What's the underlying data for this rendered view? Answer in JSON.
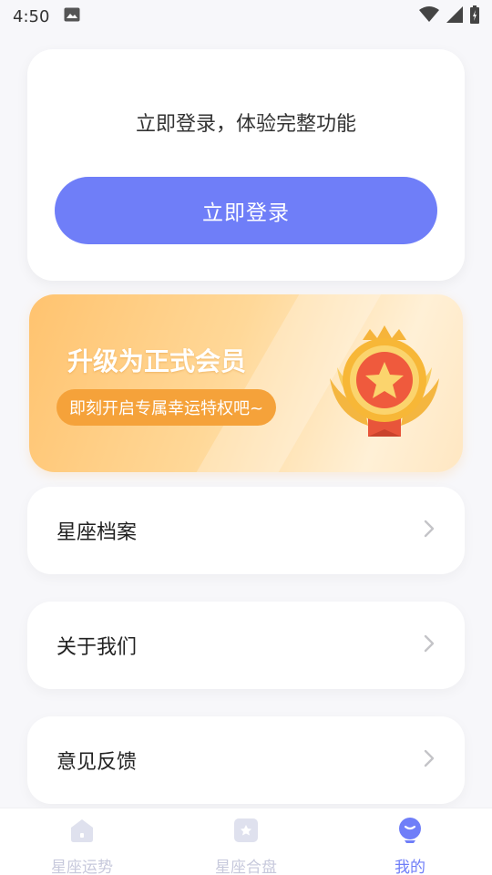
{
  "status_bar": {
    "time": "4:50"
  },
  "login_card": {
    "prompt": "立即登录，体验完整功能",
    "button_label": "立即登录"
  },
  "vip_banner": {
    "title": "升级为正式会员",
    "subtitle": "即刻开启专属幸运特权吧~"
  },
  "menu": [
    {
      "label": "星座档案"
    },
    {
      "label": "关于我们"
    },
    {
      "label": "意见反馈"
    }
  ],
  "tabs": [
    {
      "label": "星座运势",
      "icon": "house-icon",
      "active": false
    },
    {
      "label": "星座合盘",
      "icon": "star-card-icon",
      "active": false
    },
    {
      "label": "我的",
      "icon": "profile-icon",
      "active": true
    }
  ],
  "colors": {
    "accent": "#6f7ef8",
    "tab_inactive": "#c7c9dc",
    "vip_orange": "#f5a23a"
  }
}
